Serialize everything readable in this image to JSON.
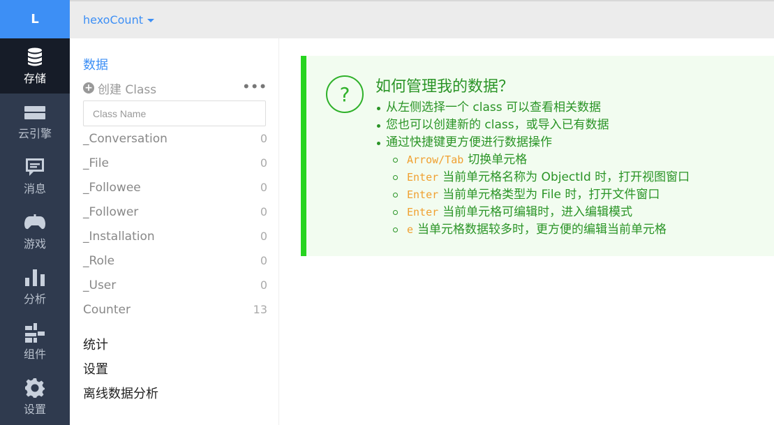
{
  "logo": "L",
  "app_name": "hexoCount",
  "rail": [
    {
      "label": "存储",
      "icon": "database-icon",
      "active": true
    },
    {
      "label": "云引擎",
      "icon": "server-icon",
      "active": false
    },
    {
      "label": "消息",
      "icon": "message-icon",
      "active": false
    },
    {
      "label": "游戏",
      "icon": "gamepad-icon",
      "active": false
    },
    {
      "label": "分析",
      "icon": "bar-chart-icon",
      "active": false
    },
    {
      "label": "组件",
      "icon": "components-icon",
      "active": false
    },
    {
      "label": "设置",
      "icon": "gear-icon",
      "active": false
    }
  ],
  "sidebar": {
    "title": "数据",
    "create_label": "创建 Class",
    "more_label": "•••",
    "class_name_placeholder": "Class Name",
    "classes": [
      {
        "name": "_Conversation",
        "count": "0"
      },
      {
        "name": "_File",
        "count": "0"
      },
      {
        "name": "_Followee",
        "count": "0"
      },
      {
        "name": "_Follower",
        "count": "0"
      },
      {
        "name": "_Installation",
        "count": "0"
      },
      {
        "name": "_Role",
        "count": "0"
      },
      {
        "name": "_User",
        "count": "0"
      },
      {
        "name": "Counter",
        "count": "13"
      }
    ],
    "links": [
      "统计",
      "设置",
      "离线数据分析"
    ]
  },
  "help": {
    "icon": "?",
    "title": "如何管理我的数据？",
    "tips": [
      "从左侧选择一个 class 可以查看相关数据",
      "您也可以创建新的 class，或导入已有数据",
      "通过快捷键更方便进行数据操作"
    ],
    "shortcuts": [
      {
        "key": "Arrow/Tab",
        "desc": "切换单元格"
      },
      {
        "key": "Enter",
        "desc": "当前单元格名称为 ObjectId 时，打开视图窗口"
      },
      {
        "key": "Enter",
        "desc": "当前单元格类型为 File 时，打开文件窗口"
      },
      {
        "key": "Enter",
        "desc": "当前单元格可编辑时，进入编辑模式"
      },
      {
        "key": "e",
        "desc": "当单元格数据较多时，更方便的编辑当前单元格"
      }
    ]
  },
  "colors": {
    "accent": "#3d8ff5",
    "rail_bg": "#2f3a4e",
    "rail_active_bg": "#161c28",
    "help_green": "#2a9426",
    "help_border": "#27d420",
    "help_bg": "#f2fcf0",
    "shortcut_key": "#f0a030"
  }
}
